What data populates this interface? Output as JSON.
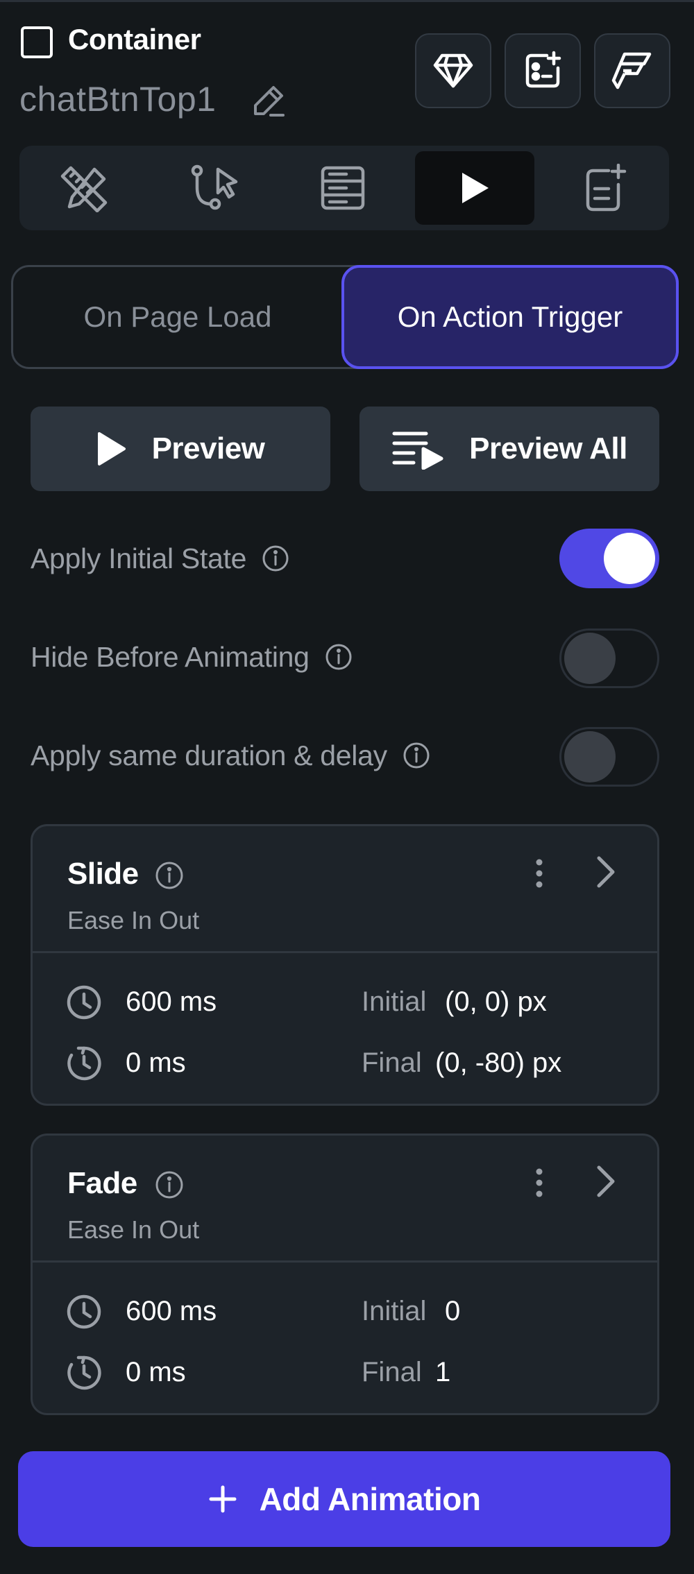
{
  "header": {
    "component_type": "Container",
    "component_name": "chatBtnTop1",
    "icons": [
      "diamond-icon",
      "widget-add-icon",
      "flutterflow-icon"
    ]
  },
  "tabs": [
    {
      "icon": "ruler-pencil-icon",
      "active": false
    },
    {
      "icon": "action-flow-icon",
      "active": false
    },
    {
      "icon": "database-icon",
      "active": false
    },
    {
      "icon": "play-icon",
      "active": true
    },
    {
      "icon": "document-add-icon",
      "active": false
    }
  ],
  "segmented": {
    "left_label": "On Page Load",
    "right_label": "On Action Trigger",
    "selected": "On Action Trigger"
  },
  "preview": {
    "preview_label": "Preview",
    "preview_all_label": "Preview All"
  },
  "toggles": [
    {
      "label": "Apply Initial State",
      "on": true
    },
    {
      "label": "Hide Before Animating",
      "on": false
    },
    {
      "label": "Apply same duration & delay",
      "on": false
    }
  ],
  "animations": [
    {
      "title": "Slide",
      "curve": "Ease In Out",
      "duration": "600 ms",
      "delay": "0 ms",
      "initial_label": "Initial",
      "initial_value": "(0, 0) px",
      "final_label": "Final",
      "final_value": "(0, -80) px"
    },
    {
      "title": "Fade",
      "curve": "Ease In Out",
      "duration": "600 ms",
      "delay": "0 ms",
      "initial_label": "Initial",
      "initial_value": "0",
      "final_label": "Final",
      "final_value": "1"
    }
  ],
  "add_button": {
    "label": "Add Animation"
  },
  "colors": {
    "background": "#14181b",
    "accent": "#4b3ee6",
    "selected_segment": "#272467",
    "toggle_on": "#5048e5"
  }
}
